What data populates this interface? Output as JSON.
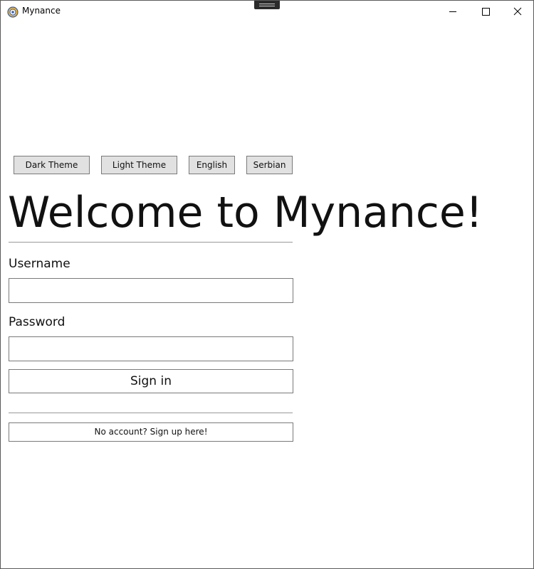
{
  "window": {
    "title": "Mynance",
    "app_icon": "mynance-gear-icon",
    "controls": {
      "minimize_icon": "minimize-icon",
      "maximize_icon": "maximize-icon",
      "close_icon": "close-icon"
    }
  },
  "toolbar": {
    "dark_theme_label": "Dark Theme",
    "light_theme_label": "Light Theme",
    "english_label": "English",
    "serbian_label": "Serbian"
  },
  "login": {
    "heading": "Welcome to Mynance!",
    "username_label": "Username",
    "username_value": "",
    "password_label": "Password",
    "password_value": "",
    "sign_in_label": "Sign in",
    "sign_up_label": "No account? Sign up here!"
  },
  "colors": {
    "text": "#111111",
    "button_background": "#e1e1e1",
    "border": "#7a7a7a",
    "divider": "#9a9a9a",
    "icon_yellow": "#e8b23a",
    "icon_blue": "#3a5fa8"
  }
}
